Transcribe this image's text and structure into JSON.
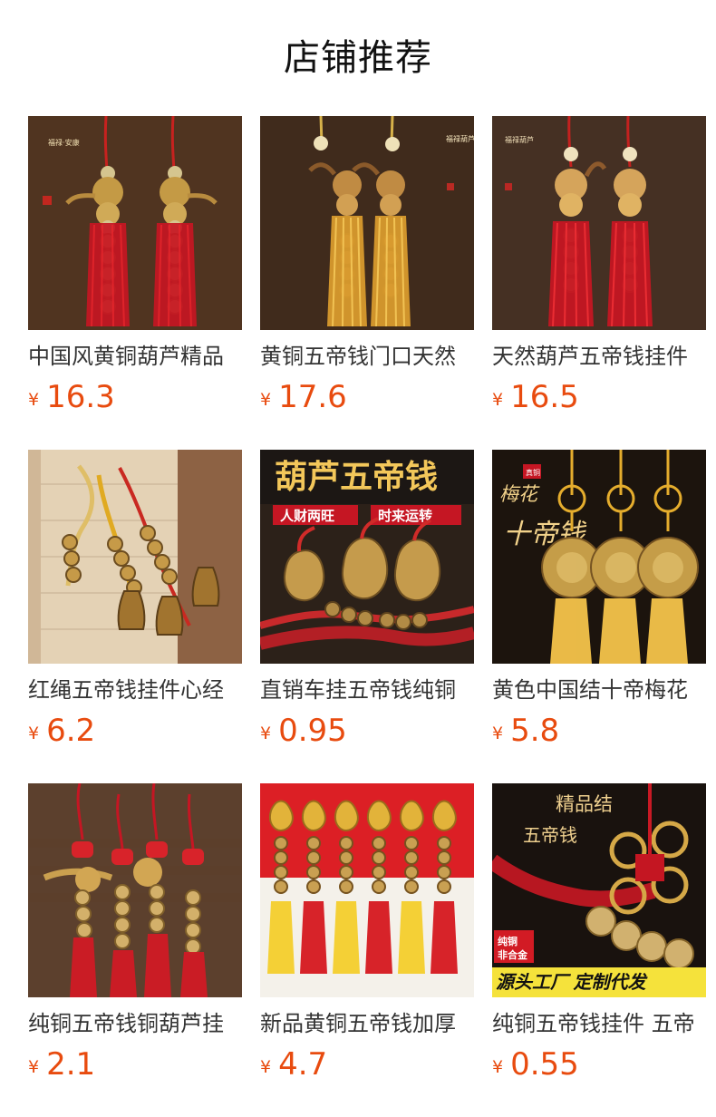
{
  "header": {
    "title": "店铺推荐"
  },
  "products": [
    {
      "title": "中国风黄铜葫芦精品",
      "currency": "¥",
      "price": "16.3",
      "icon": "brass-gourd-red-tassel-icon",
      "bg": "#5b3b24"
    },
    {
      "title": "黄铜五帝钱门口天然",
      "currency": "¥",
      "price": "17.6",
      "icon": "natural-gourd-yellow-tassel-icon",
      "bg": "#4a3322"
    },
    {
      "title": "天然葫芦五帝钱挂件",
      "currency": "¥",
      "price": "16.5",
      "icon": "natural-gourd-red-tassel-icon",
      "bg": "#4d3628"
    },
    {
      "title": "红绳五帝钱挂件心经",
      "currency": "¥",
      "price": "6.2",
      "icon": "coin-bell-hanging-icon",
      "bg": "#d9c4a5"
    },
    {
      "title": "直销车挂五帝钱纯铜",
      "currency": "¥",
      "price": "0.95",
      "icon": "gourd-coin-car-pendant-icon",
      "bg": "#2c2119"
    },
    {
      "title": "黄色中国结十帝梅花",
      "currency": "¥",
      "price": "5.8",
      "icon": "plum-coin-yellow-knot-icon",
      "bg": "#1c140d"
    },
    {
      "title": "纯铜五帝钱铜葫芦挂",
      "currency": "¥",
      "price": "2.1",
      "icon": "red-knot-coin-string-icon",
      "bg": "#6a4a35"
    },
    {
      "title": "新品黄铜五帝钱加厚",
      "currency": "¥",
      "price": "4.7",
      "icon": "red-yellow-tassel-rows-icon",
      "bg": "#f4f1ea"
    },
    {
      "title": "纯铜五帝钱挂件 五帝",
      "currency": "¥",
      "price": "0.55",
      "icon": "chinese-knot-coin-banner-icon",
      "bg": "#1f1712"
    }
  ],
  "image_texts": [
    "福禄·安康",
    "福禄葫芦",
    "福禄葫芦",
    "葫芦五帝钱",
    "人财两旺",
    "时来运转",
    "真铜",
    "梅花",
    "十帝钱",
    "精品结",
    "五帝钱",
    "纯铜",
    "非合金",
    "源头工厂 定制代发"
  ]
}
